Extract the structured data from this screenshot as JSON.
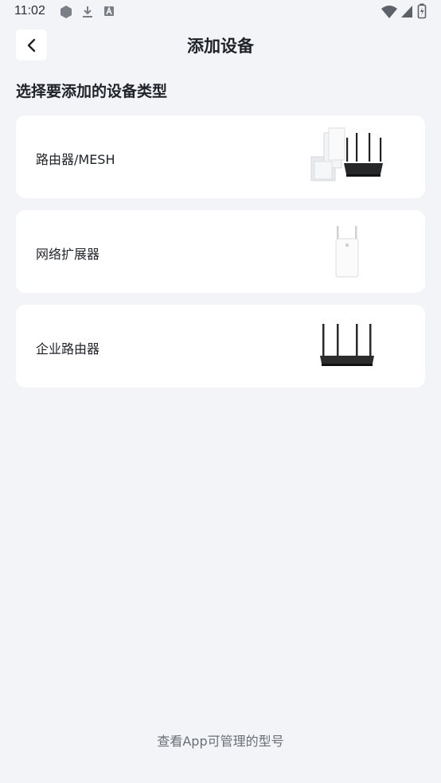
{
  "status_bar": {
    "time": "11:02"
  },
  "header": {
    "title": "添加设备"
  },
  "section": {
    "title": "选择要添加的设备类型"
  },
  "device_types": [
    {
      "label": "路由器/MESH",
      "image": "router-mesh-image"
    },
    {
      "label": "网络扩展器",
      "image": "extender-image"
    },
    {
      "label": "企业路由器",
      "image": "enterprise-router-image"
    }
  ],
  "footer": {
    "link": "查看App可管理的型号"
  },
  "colors": {
    "background": "#f2f4f7",
    "card": "#ffffff",
    "text": "#1f2329",
    "muted": "#6b7078"
  }
}
